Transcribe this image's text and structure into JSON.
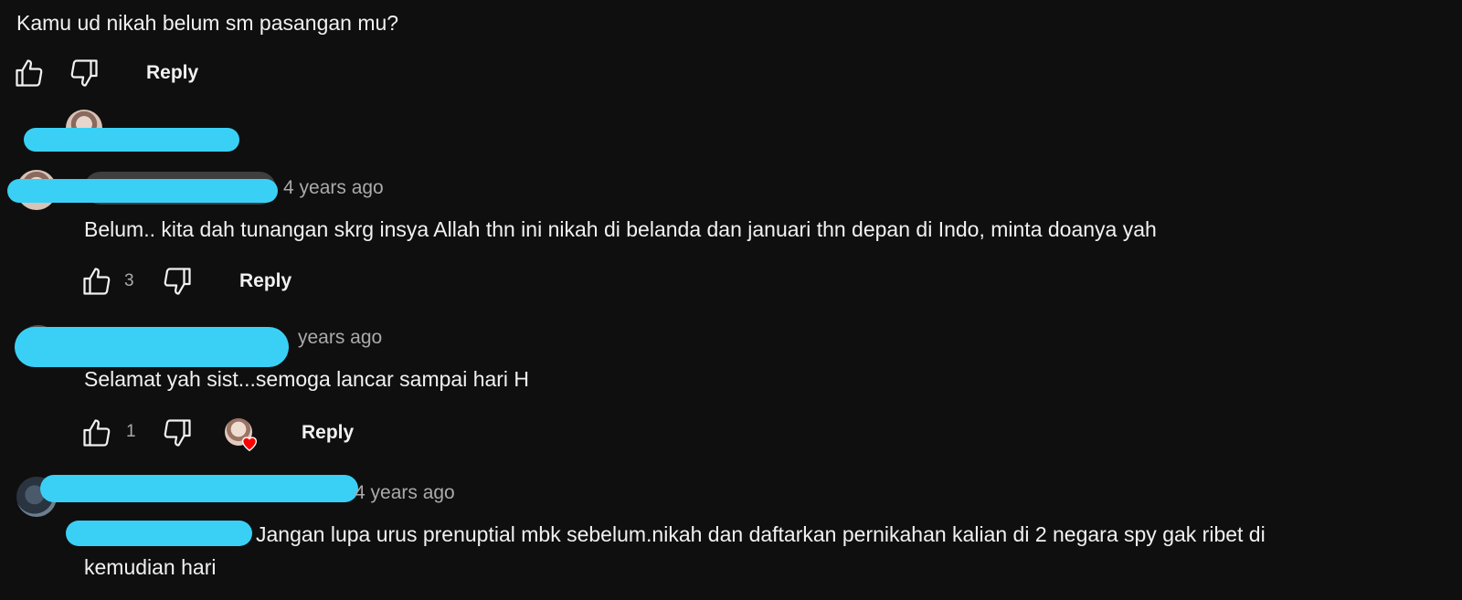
{
  "comment_top": {
    "text": "Kamu ud nikah belum sm pasangan mu?",
    "reply_label": "Reply"
  },
  "replies": [
    {
      "timestamp": "4 years ago",
      "text": "Belum.. kita dah tunangan skrg insya Allah thn ini nikah di belanda dan januari thn depan di Indo, minta doanya yah",
      "likes": "3",
      "reply_label": "Reply"
    },
    {
      "timestamp": "years ago",
      "text": "Selamat yah sist...semoga lancar sampai hari H",
      "likes": "1",
      "reply_label": "Reply"
    },
    {
      "timestamp": "4 years ago",
      "text_line1": "Jangan lupa urus prenuptial mbk sebelum.nikah dan daftarkan pernikahan kalian di 2 negara spy gak ribet di",
      "text_line2": "kemudian hari"
    }
  ],
  "icons": {
    "like": "thumbs-up-icon",
    "dislike": "thumbs-down-icon",
    "heart": "creator-heart-icon"
  },
  "colors": {
    "background": "#0f0f0f",
    "text": "#f1f1f1",
    "meta": "#aaaaaa",
    "redaction": "#3ad0f5",
    "heart": "#ff0000"
  }
}
